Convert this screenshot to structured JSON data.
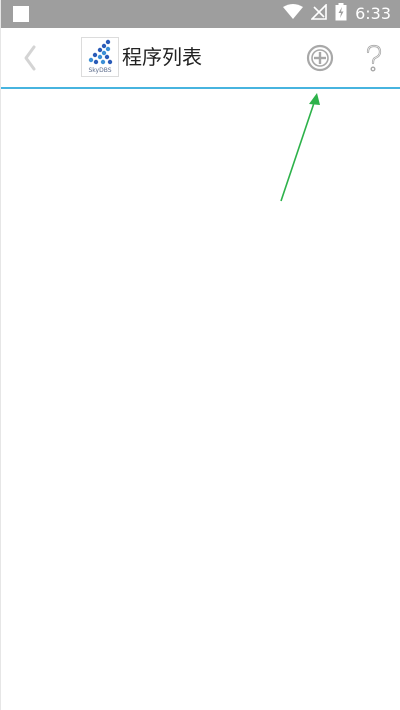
{
  "status_bar": {
    "time": "6:33",
    "icons": [
      "notification-square-icon",
      "wifi-icon",
      "signal-off-icon",
      "battery-charging-icon"
    ]
  },
  "app_bar": {
    "title": "程序列表",
    "logo_text": "SkyDBS",
    "back_icon": "chevron-left-icon",
    "add_icon": "circle-plus-icon",
    "help_icon": "question-mark-icon",
    "accent_color": "#47b4df"
  },
  "program_list": {
    "items": []
  },
  "annotation": {
    "arrow_color": "#2db24a",
    "target": "add-button"
  }
}
